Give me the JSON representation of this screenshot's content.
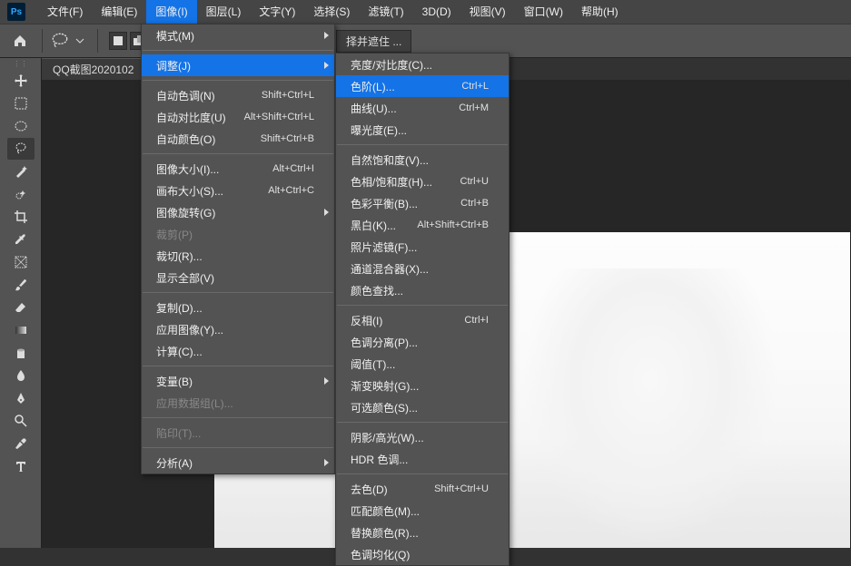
{
  "app": {
    "logo": "Ps"
  },
  "menubar": [
    "文件(F)",
    "编辑(E)",
    "图像(I)",
    "图层(L)",
    "文字(Y)",
    "选择(S)",
    "滤镜(T)",
    "3D(D)",
    "视图(V)",
    "窗口(W)",
    "帮助(H)"
  ],
  "optionbar": {
    "mask_button": "择并遮住 ..."
  },
  "tab": {
    "title": "QQ截图2020102"
  },
  "image_menu": [
    {
      "t": "item",
      "label": "模式(M)",
      "arrow": true
    },
    {
      "t": "sep"
    },
    {
      "t": "item",
      "label": "调整(J)",
      "arrow": true,
      "hot": true
    },
    {
      "t": "sep"
    },
    {
      "t": "item",
      "label": "自动色调(N)",
      "shortcut": "Shift+Ctrl+L"
    },
    {
      "t": "item",
      "label": "自动对比度(U)",
      "shortcut": "Alt+Shift+Ctrl+L"
    },
    {
      "t": "item",
      "label": "自动颜色(O)",
      "shortcut": "Shift+Ctrl+B"
    },
    {
      "t": "sep"
    },
    {
      "t": "item",
      "label": "图像大小(I)...",
      "shortcut": "Alt+Ctrl+I"
    },
    {
      "t": "item",
      "label": "画布大小(S)...",
      "shortcut": "Alt+Ctrl+C"
    },
    {
      "t": "item",
      "label": "图像旋转(G)",
      "arrow": true
    },
    {
      "t": "item",
      "label": "裁剪(P)",
      "disabled": true
    },
    {
      "t": "item",
      "label": "裁切(R)..."
    },
    {
      "t": "item",
      "label": "显示全部(V)"
    },
    {
      "t": "sep"
    },
    {
      "t": "item",
      "label": "复制(D)..."
    },
    {
      "t": "item",
      "label": "应用图像(Y)..."
    },
    {
      "t": "item",
      "label": "计算(C)..."
    },
    {
      "t": "sep"
    },
    {
      "t": "item",
      "label": "变量(B)",
      "arrow": true
    },
    {
      "t": "item",
      "label": "应用数据组(L)...",
      "disabled": true
    },
    {
      "t": "sep"
    },
    {
      "t": "item",
      "label": "陷印(T)...",
      "disabled": true
    },
    {
      "t": "sep"
    },
    {
      "t": "item",
      "label": "分析(A)",
      "arrow": true
    }
  ],
  "adjust_menu": [
    {
      "t": "item",
      "label": "亮度/对比度(C)..."
    },
    {
      "t": "item",
      "label": "色阶(L)...",
      "shortcut": "Ctrl+L",
      "hot": true
    },
    {
      "t": "item",
      "label": "曲线(U)...",
      "shortcut": "Ctrl+M"
    },
    {
      "t": "item",
      "label": "曝光度(E)..."
    },
    {
      "t": "sep"
    },
    {
      "t": "item",
      "label": "自然饱和度(V)..."
    },
    {
      "t": "item",
      "label": "色相/饱和度(H)...",
      "shortcut": "Ctrl+U"
    },
    {
      "t": "item",
      "label": "色彩平衡(B)...",
      "shortcut": "Ctrl+B"
    },
    {
      "t": "item",
      "label": "黑白(K)...",
      "shortcut": "Alt+Shift+Ctrl+B"
    },
    {
      "t": "item",
      "label": "照片滤镜(F)..."
    },
    {
      "t": "item",
      "label": "通道混合器(X)..."
    },
    {
      "t": "item",
      "label": "颜色查找..."
    },
    {
      "t": "sep"
    },
    {
      "t": "item",
      "label": "反相(I)",
      "shortcut": "Ctrl+I"
    },
    {
      "t": "item",
      "label": "色调分离(P)..."
    },
    {
      "t": "item",
      "label": "阈值(T)..."
    },
    {
      "t": "item",
      "label": "渐变映射(G)..."
    },
    {
      "t": "item",
      "label": "可选颜色(S)..."
    },
    {
      "t": "sep"
    },
    {
      "t": "item",
      "label": "阴影/高光(W)..."
    },
    {
      "t": "item",
      "label": "HDR 色调..."
    },
    {
      "t": "sep"
    },
    {
      "t": "item",
      "label": "去色(D)",
      "shortcut": "Shift+Ctrl+U"
    },
    {
      "t": "item",
      "label": "匹配颜色(M)..."
    },
    {
      "t": "item",
      "label": "替换颜色(R)..."
    },
    {
      "t": "item",
      "label": "色调均化(Q)"
    }
  ]
}
